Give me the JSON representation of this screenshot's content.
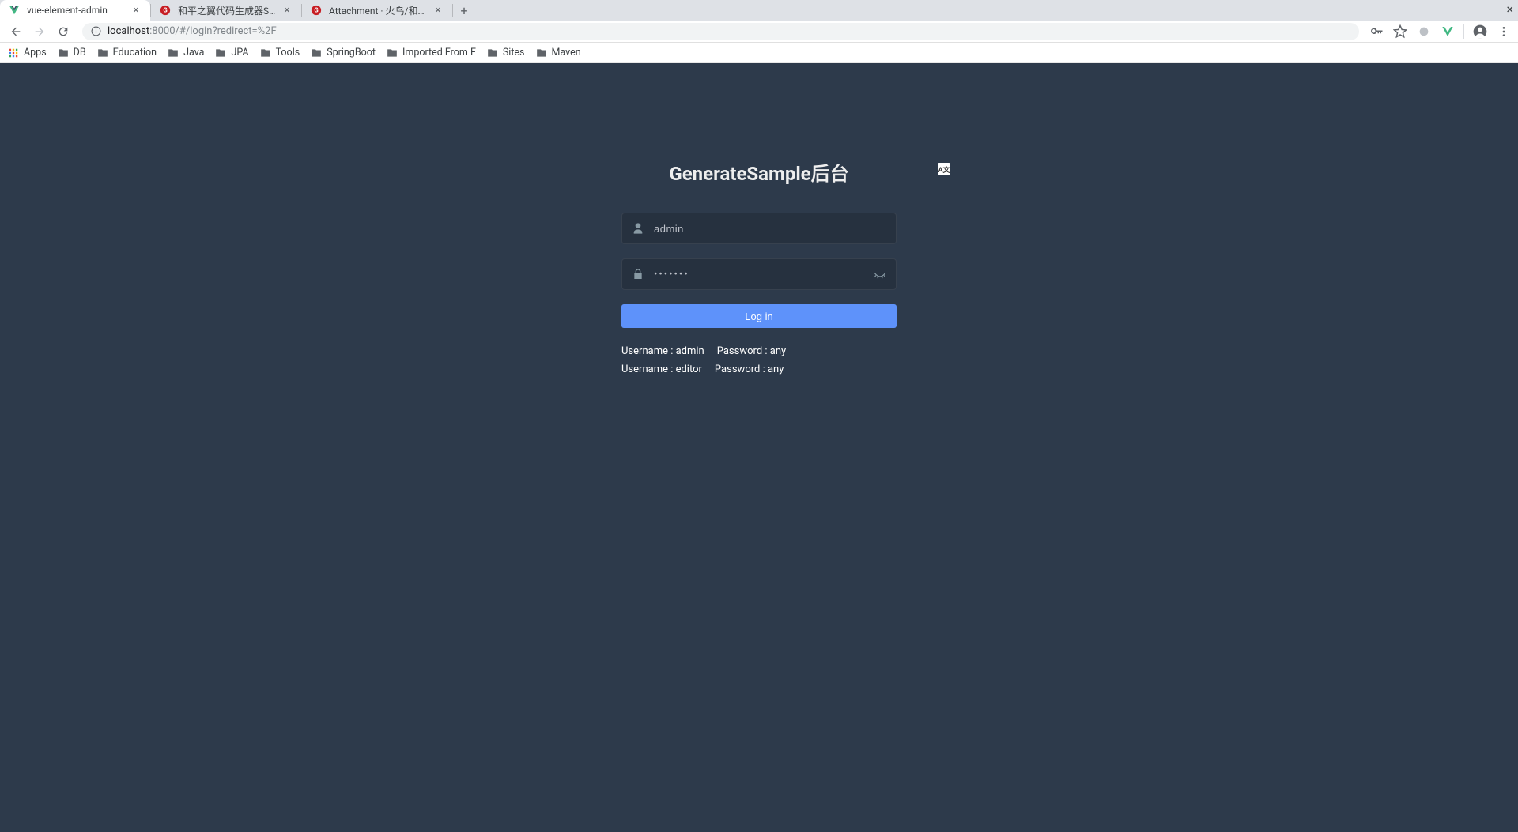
{
  "browser": {
    "tabs": [
      {
        "title": "vue-element-admin",
        "favicon": "vue"
      },
      {
        "title": "和平之翼代码生成器SMEU",
        "favicon": "red-g"
      },
      {
        "title": "Attachment · 火鸟/和平之",
        "favicon": "red-g"
      }
    ],
    "url_host": "localhost",
    "url_rest": ":8000/#/login?redirect=%2F",
    "bookmarks": [
      {
        "label": "Apps",
        "type": "apps"
      },
      {
        "label": "DB",
        "type": "folder"
      },
      {
        "label": "Education",
        "type": "folder"
      },
      {
        "label": "Java",
        "type": "folder"
      },
      {
        "label": "JPA",
        "type": "folder"
      },
      {
        "label": "Tools",
        "type": "folder"
      },
      {
        "label": "SpringBoot",
        "type": "folder"
      },
      {
        "label": "Imported From F",
        "type": "folder"
      },
      {
        "label": "Sites",
        "type": "folder"
      },
      {
        "label": "Maven",
        "type": "folder"
      }
    ]
  },
  "login": {
    "title": "GenerateSample后台",
    "lang_badge": "A文",
    "username_value": "admin",
    "password_mask": "•••••••",
    "button_label": "Log in",
    "hints": {
      "row1_user": "Username : admin",
      "row1_pass": "Password : any",
      "row2_user": "Username : editor",
      "row2_pass": "Password : any"
    }
  }
}
